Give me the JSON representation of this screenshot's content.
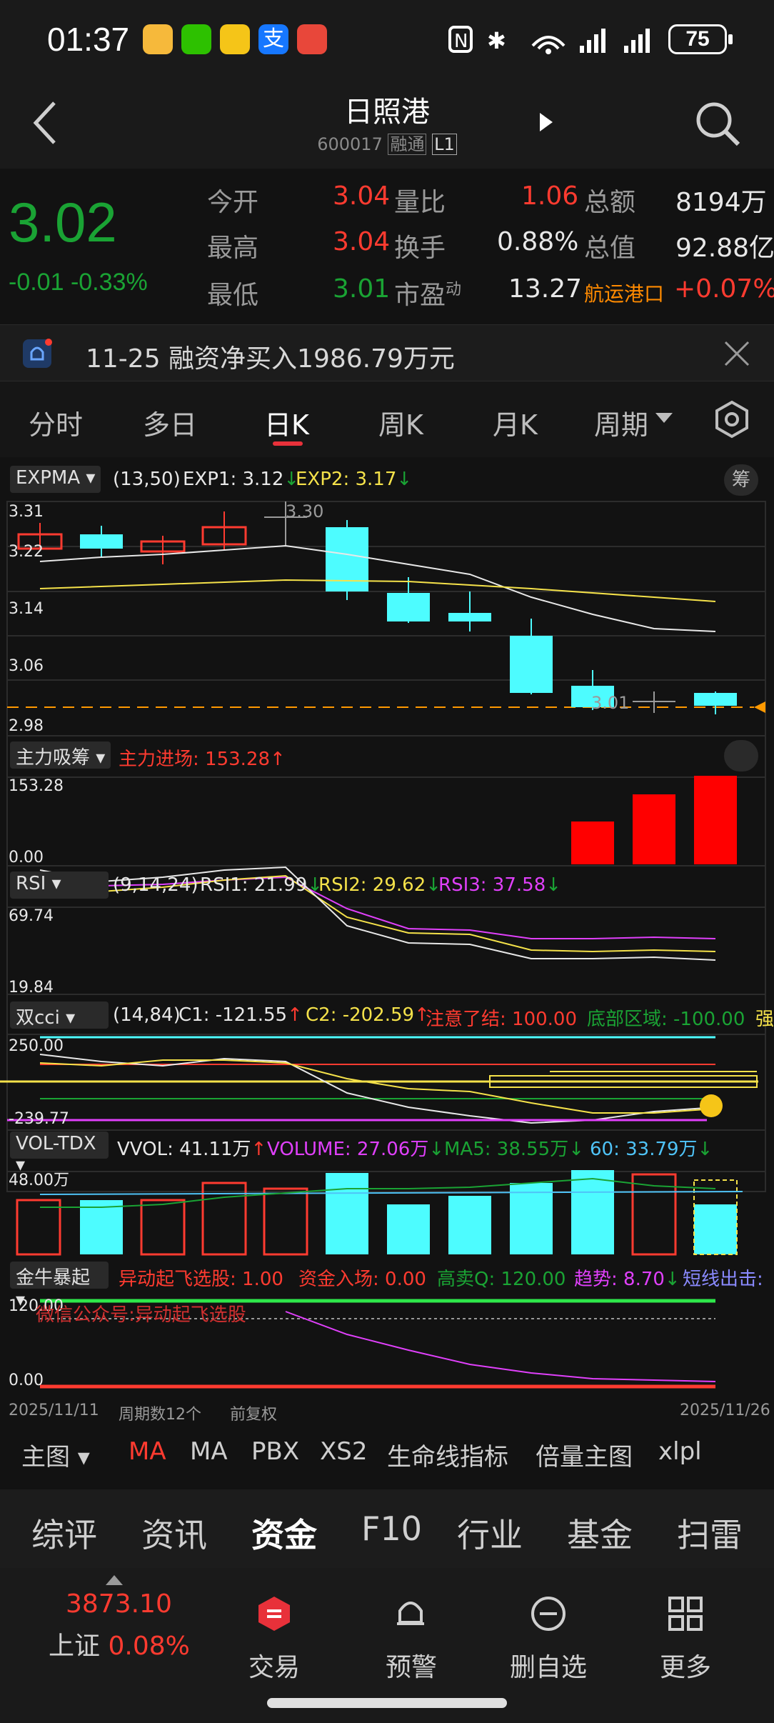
{
  "status_bar": {
    "time": "01:37",
    "battery": "75"
  },
  "header": {
    "title": "日照港",
    "code": "600017",
    "tag1": "融通",
    "tag2": "L1"
  },
  "quote": {
    "price": "3.02",
    "change": "-0.01",
    "change_pct": "-0.33%",
    "rows": [
      {
        "l1": "今开",
        "v1": "3.04",
        "l2": "量比",
        "v2": "1.06",
        "l3": "总额",
        "v3": "8194万"
      },
      {
        "l1": "最高",
        "v1": "3.04",
        "l2": "换手",
        "v2": "0.88%",
        "l3": "总值",
        "v3": "92.88亿"
      },
      {
        "l1": "最低",
        "v1": "3.01",
        "l2": "市盈",
        "v2": "13.27",
        "l3": "航运港口",
        "v3": "+0.07%"
      }
    ],
    "pe_superscript": "动"
  },
  "notice": {
    "text": "11-25 融资净买入1986.79万元"
  },
  "tabs": [
    "分时",
    "多日",
    "日K",
    "周K",
    "月K",
    "周期"
  ],
  "active_tab": "日K",
  "chart": {
    "expma": {
      "btn": "EXPMA",
      "params": "(13,50)",
      "exp1": "EXP1: 3.12",
      "exp2": "EXP2: 3.17",
      "chip_btn": "筹"
    },
    "price_axis": [
      "3.31",
      "3.22",
      "3.14",
      "3.06",
      "2.98"
    ],
    "high_label": "3.30",
    "low_label": "3.01",
    "zhuli": {
      "btn": "主力吸筹",
      "label": "主力进场: 153.28",
      "axis_top": "153.28",
      "axis_bottom": "0.00"
    },
    "rsi": {
      "btn": "RSI",
      "params": "(9,14,24)",
      "rsi1": "RSI1: 21.99",
      "rsi2": "RSI2: 29.62",
      "rsi3": "RSI3: 37.58",
      "axis_top": "69.74",
      "axis_bottom": "19.84"
    },
    "cci": {
      "btn": "双cci",
      "params": "(14,84)",
      "c1": "C1: -121.55",
      "c2": "C2: -202.59",
      "warn": "注意了结: 100.00",
      "bottom": "底部区域: -100.00",
      "strong": "强",
      "axis_top": "250.00",
      "axis_bottom": "-239.77"
    },
    "vol": {
      "btn": "VOL-TDX",
      "vvol": "VVOL: 41.11万",
      "volume": "VOLUME: 27.06万",
      "ma5": "MA5: 38.55万",
      "ma60": "60: 33.79万",
      "axis_top": "48.00万"
    },
    "jinniu": {
      "btn": "金牛暴起",
      "a": "异动起飞选股: 1.00",
      "b": "资金入场: 0.00",
      "c": "高卖Q: 120.00",
      "d": "趋势: 8.70",
      "e": "短线出击:",
      "axis_top": "120.00",
      "axis_bottom": "0.00",
      "watermark": "微信公众号:异动起飞选股"
    },
    "date_start": "2025/11/11",
    "period_count": "周期数12个",
    "adjust": "前复权",
    "date_end": "2025/11/26"
  },
  "indicator_bar": [
    "主图",
    "MA",
    "MA",
    "PBX",
    "XS2",
    "生命线指标",
    "倍量主图",
    "xlpl"
  ],
  "sub_tabs": [
    "综评",
    "资讯",
    "资金",
    "F10",
    "行业",
    "基金",
    "扫雷"
  ],
  "active_sub_tab": "资金",
  "bottom_bar": {
    "index_value": "3873.10",
    "index_name": "上证",
    "index_pct": "0.08%",
    "items": [
      "交易",
      "预警",
      "删自选",
      "更多"
    ]
  },
  "colors": {
    "up": "#ff3b30",
    "down": "#1aa334",
    "candle_down": "#4dfcff",
    "accent": "#e8313a"
  }
}
